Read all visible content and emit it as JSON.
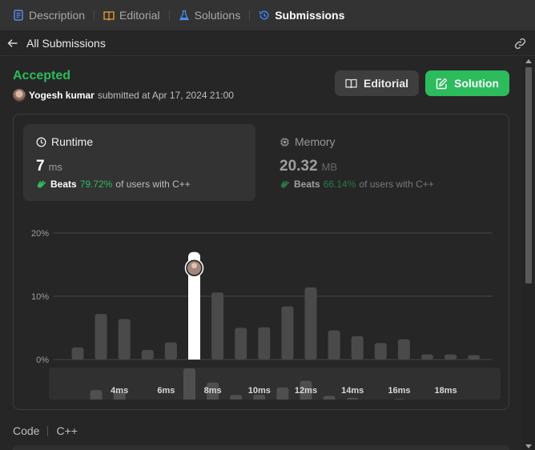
{
  "tabs": [
    {
      "label": "Description",
      "icon": "description-icon"
    },
    {
      "label": "Editorial",
      "icon": "book-icon"
    },
    {
      "label": "Solutions",
      "icon": "flask-icon"
    },
    {
      "label": "Submissions",
      "icon": "history-icon",
      "active": true
    }
  ],
  "subheader": {
    "back_label": "All Submissions"
  },
  "submission": {
    "status": "Accepted",
    "author": "Yogesh kumar",
    "submitted_text": "submitted at Apr 17, 2024 21:00"
  },
  "buttons": {
    "editorial": "Editorial",
    "solution": "Solution"
  },
  "runtime": {
    "title": "Runtime",
    "value": "7",
    "unit": "ms",
    "beats_label": "Beats",
    "beats_pct": "79.72%",
    "beats_suffix": "of users with C++"
  },
  "memory": {
    "title": "Memory",
    "value": "20.32",
    "unit": "MB",
    "beats_label": "Beats",
    "beats_pct": "66.14%",
    "beats_suffix": "of users with C++"
  },
  "code": {
    "label": "Code",
    "language": "C++"
  },
  "colors": {
    "accent": "#2cbb5d",
    "bar": "#4a4a4a",
    "highlight": "#ffffff",
    "active_tab_icon": "#3b82f6"
  },
  "chart_data": {
    "type": "bar",
    "y_ticks": [
      "20%",
      "10%",
      "0%"
    ],
    "ylim": [
      0,
      20
    ],
    "x_tick_labels": [
      "4ms",
      "6ms",
      "8ms",
      "10ms",
      "12ms",
      "14ms",
      "16ms",
      "18ms"
    ],
    "categories": [
      "2ms",
      "3ms",
      "4ms",
      "5ms",
      "6ms",
      "7ms",
      "8ms",
      "9ms",
      "10ms",
      "11ms",
      "12ms",
      "13ms",
      "14ms",
      "15ms",
      "16ms",
      "17ms",
      "18ms",
      "19ms"
    ],
    "values": [
      1.9,
      7.2,
      6.4,
      1.5,
      2.7,
      17.0,
      10.6,
      5.0,
      5.1,
      8.4,
      11.4,
      4.6,
      3.7,
      2.6,
      3.2,
      0.8,
      0.8,
      0.7
    ],
    "highlight_category": "7ms",
    "grid": true
  }
}
